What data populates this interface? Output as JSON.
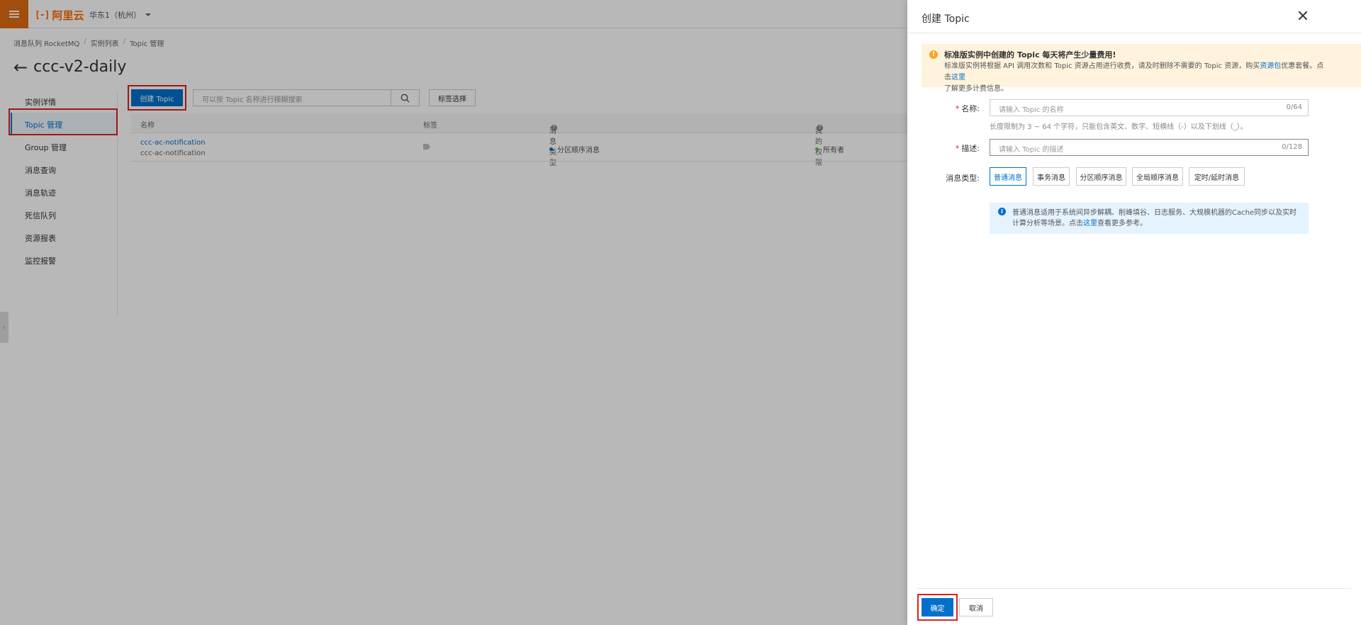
{
  "topbar": {
    "logo_text": "阿里云",
    "region": "华东1（杭州）"
  },
  "breadcrumb": [
    "消息队列 RocketMQ",
    "实例列表",
    "Topic 管理"
  ],
  "page_title": "ccc-v2-daily",
  "sidenav": {
    "items": [
      {
        "label": "实例详情"
      },
      {
        "label": "Topic 管理"
      },
      {
        "label": "Group 管理"
      },
      {
        "label": "消息查询"
      },
      {
        "label": "消息轨迹"
      },
      {
        "label": "死信队列"
      },
      {
        "label": "资源报表"
      },
      {
        "label": "监控报警"
      }
    ],
    "active_index": 1
  },
  "toolbar": {
    "create_label": "创建 Topic",
    "search_placeholder": "可以按 Topic 名称进行模糊搜索",
    "tag_filter_label": "标签选择"
  },
  "table": {
    "columns": [
      "名称",
      "标签",
      "消息类型",
      "我的权限"
    ],
    "rows": [
      {
        "name": "ccc-ac-notification",
        "desc": "ccc-ac-notification",
        "type": "分区顺序消息",
        "permission": "所有者"
      }
    ]
  },
  "drawer": {
    "title": "创建 Topic",
    "warning": {
      "title": "标准版实例中创建的 Topic 每天将产生少量费用!",
      "body_1": "标准版实例将根据 API 调用次数和 Topic 资源占用进行收费，请及时删除不需要的 Topic 资源，购买",
      "link_1": "资源包",
      "body_2": "优惠套餐。点击",
      "link_2": "这里",
      "body_3": "了解更多计费信息。"
    },
    "name_field": {
      "label": "名称:",
      "placeholder": "请输入 Topic 的名称",
      "count": "0/64",
      "hint": "长度限制为 3 ~ 64 个字符，只能包含英文、数字、短横线（-）以及下划线（_）。"
    },
    "desc_field": {
      "label": "描述:",
      "placeholder": "请输入 Topic 的描述",
      "count": "0/128"
    },
    "msg_type": {
      "label": "消息类型:",
      "options": [
        "普通消息",
        "事务消息",
        "分区顺序消息",
        "全局顺序消息",
        "定时/延时消息"
      ],
      "selected_index": 0
    },
    "info": {
      "body_1": "普通消息适用于系统间异步解耦、削峰填谷、日志服务、大规模机器的Cache同步以及实时计算分析等场景。点击",
      "link": "这里",
      "body_2": "查看更多参考。"
    },
    "ok_label": "确定",
    "cancel_label": "取消"
  },
  "colors": {
    "primary": "#0070cc",
    "brand_orange": "#ff6a00",
    "highlight_red": "#e02020",
    "warning_bg": "#fff3dd",
    "info_bg": "#e5f3ff"
  }
}
